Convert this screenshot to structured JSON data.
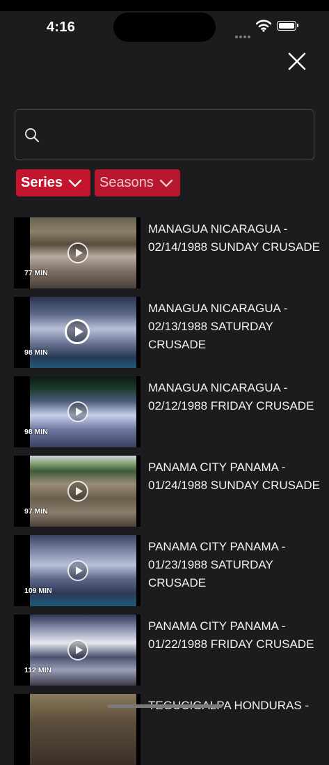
{
  "status": {
    "time": "4:16"
  },
  "search": {
    "placeholder": ""
  },
  "filters": {
    "series_label": "Series",
    "seasons_label": "Seasons"
  },
  "colors": {
    "accent": "#c4152e",
    "background": "#1c1c1e"
  },
  "videos": [
    {
      "duration": "77 MIN",
      "title": "MANAGUA NICARAGUA - 02/14/1988 SUNDAY CRUSADE"
    },
    {
      "duration": "98 MIN",
      "title": "MANAGUA NICARAGUA - 02/13/1988 SATURDAY CRUSADE"
    },
    {
      "duration": "98 MIN",
      "title": "MANAGUA NICARAGUA - 02/12/1988 FRIDAY CRUSADE"
    },
    {
      "duration": "97 MIN",
      "title": "PANAMA CITY PANAMA - 01/24/1988 SUNDAY CRUSADE"
    },
    {
      "duration": "109 MIN",
      "title": "PANAMA CITY PANAMA - 01/23/1988 SATURDAY CRUSADE"
    },
    {
      "duration": "112 MIN",
      "title": "PANAMA CITY PANAMA - 01/22/1988 FRIDAY CRUSADE"
    },
    {
      "duration": "",
      "title": "TEGUCIGALPA HONDURAS -"
    }
  ]
}
